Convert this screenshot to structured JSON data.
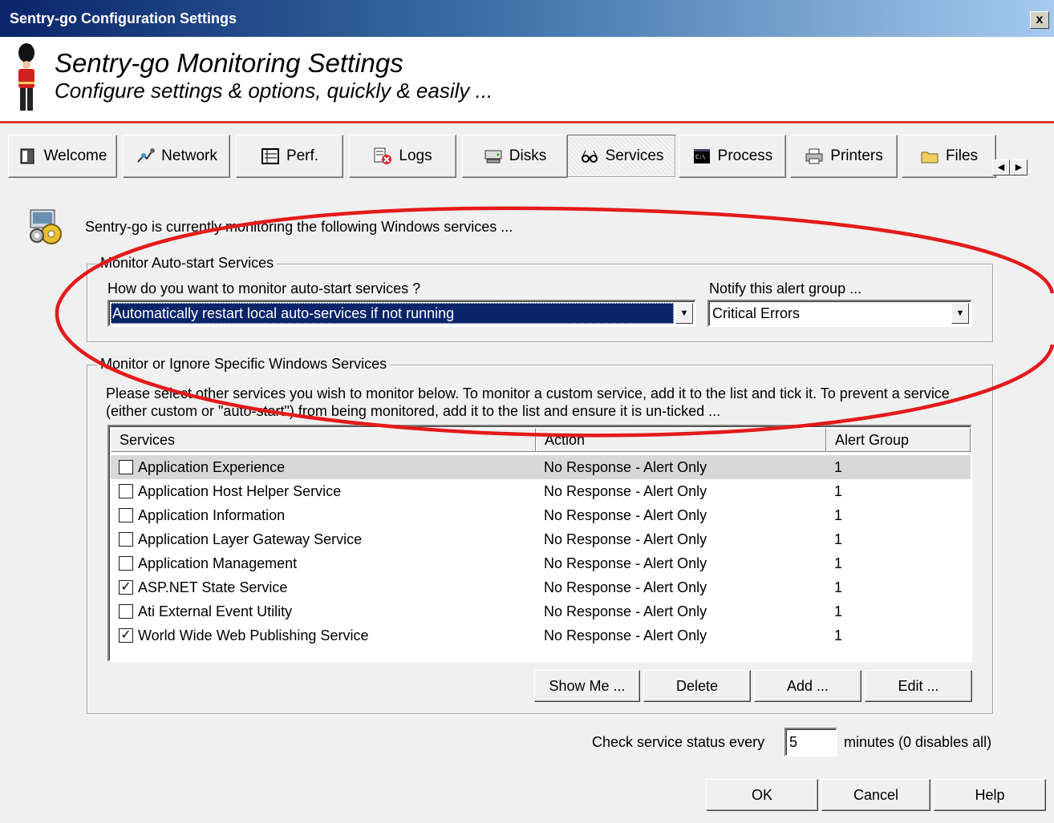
{
  "window": {
    "title": "Sentry-go Configuration Settings",
    "close_label": "x"
  },
  "header": {
    "title": "Sentry-go Monitoring Settings",
    "subtitle": "Configure settings & options, quickly & easily ..."
  },
  "tabs": [
    {
      "label": "Welcome",
      "icon": "book-icon"
    },
    {
      "label": "Network",
      "icon": "network-icon"
    },
    {
      "label": "Perf.",
      "icon": "performance-icon"
    },
    {
      "label": "Logs",
      "icon": "logs-icon"
    },
    {
      "label": "Disks",
      "icon": "disk-icon"
    },
    {
      "label": "Services",
      "icon": "glasses-icon",
      "active": true
    },
    {
      "label": "Process",
      "icon": "console-icon"
    },
    {
      "label": "Printers",
      "icon": "printer-icon"
    },
    {
      "label": "Files",
      "icon": "folder-icon"
    }
  ],
  "intro_text": "Sentry-go is currently monitoring the following Windows services ...",
  "auto_start": {
    "legend": "Monitor Auto-start Services",
    "question": "How do you want to monitor auto-start services ?",
    "mode_value": "Automatically restart local auto-services if not running",
    "notify_label": "Notify this alert group ...",
    "notify_value": "Critical Errors"
  },
  "specific": {
    "legend": "Monitor or Ignore Specific Windows Services",
    "description": "Please select other services you wish to monitor below. To monitor a custom service, add it to the list and tick it. To prevent a service (either custom or \"auto-start\") from being monitored, add it to the list and ensure it is un-ticked ...",
    "columns": [
      "Services",
      "Action",
      "Alert Group"
    ],
    "rows": [
      {
        "name": "Application Experience",
        "action": "No Response - Alert Only",
        "group": "1",
        "checked": false
      },
      {
        "name": "Application Host Helper Service",
        "action": "No Response - Alert Only",
        "group": "1",
        "checked": false
      },
      {
        "name": "Application Information",
        "action": "No Response - Alert Only",
        "group": "1",
        "checked": false
      },
      {
        "name": "Application Layer Gateway Service",
        "action": "No Response - Alert Only",
        "group": "1",
        "checked": false
      },
      {
        "name": "Application Management",
        "action": "No Response - Alert Only",
        "group": "1",
        "checked": false
      },
      {
        "name": "ASP.NET State Service",
        "action": "No Response - Alert Only",
        "group": "1",
        "checked": true
      },
      {
        "name": "Ati External Event Utility",
        "action": "No Response - Alert Only",
        "group": "1",
        "checked": false
      },
      {
        "name": "World Wide Web Publishing Service",
        "action": "No Response - Alert Only",
        "group": "1",
        "checked": true
      }
    ],
    "buttons": {
      "show_me": "Show Me ...",
      "delete": "Delete",
      "add": "Add ...",
      "edit": "Edit ..."
    }
  },
  "interval": {
    "label_before": "Check service status every",
    "value": "5",
    "label_after": "minutes (0 disables all)"
  },
  "footer": {
    "ok": "OK",
    "cancel": "Cancel",
    "help": "Help"
  },
  "colors": {
    "title_start": "#0a246a",
    "accent_line": "#d2402e",
    "annotation": "#e41a1a",
    "selection": "#0a246a"
  }
}
